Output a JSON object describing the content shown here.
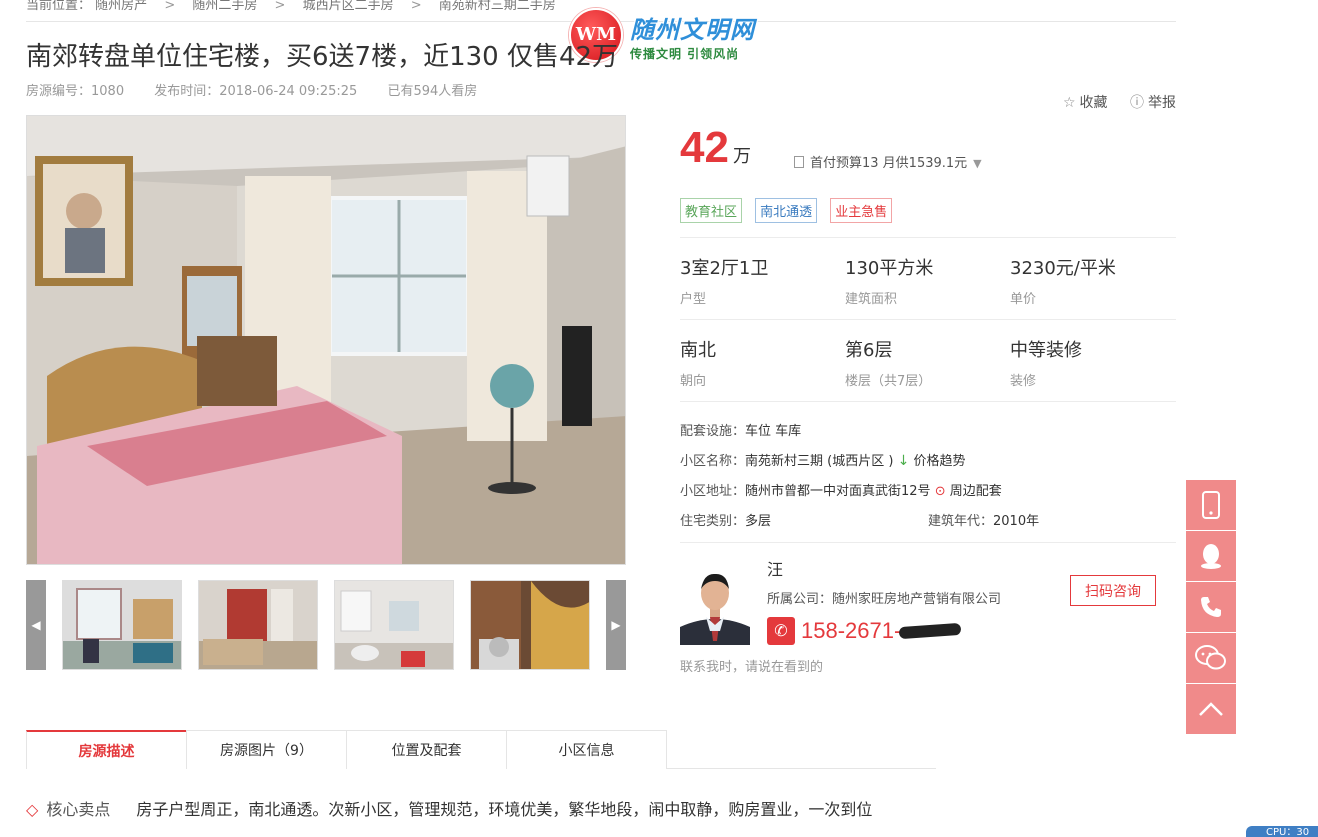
{
  "breadcrumb": {
    "prefix": "当前位置：",
    "items": [
      "随州房产",
      "随州二手房",
      "城西片区二手房",
      "南苑新村三期二手房"
    ],
    "sep": ">"
  },
  "logo": {
    "mark": "WM",
    "title": "随州文明网",
    "slogan": "传播文明  引领风尚"
  },
  "listing": {
    "title": "南郊转盘单位住宅楼，买6送7楼，近130 仅售42万",
    "code": "房源编号：1080",
    "published": "发布时间：2018-06-24 09:25:25",
    "views": "已有594人看房"
  },
  "actions": {
    "favorite": "收藏",
    "report": "举报"
  },
  "gallery": {
    "prev": "◀",
    "next": "▶"
  },
  "price": {
    "value": "42",
    "unit": "万",
    "budget": "首付预算13 月供1539.1元"
  },
  "tags": [
    "教育社区",
    "南北通透",
    "业主急售"
  ],
  "specs": [
    {
      "value": "3室2厅1卫",
      "label": "户型"
    },
    {
      "value": "130平方米",
      "label": "建筑面积"
    },
    {
      "value": "3230元/平米",
      "label": "单价"
    },
    {
      "value": "南北",
      "label": "朝向"
    },
    {
      "value": "第6层",
      "label": "楼层（共7层）"
    },
    {
      "value": "中等装修",
      "label": "装修"
    }
  ],
  "info": {
    "facilities_label": "配套设施：",
    "facilities_value": "车位 车库",
    "community_label": "小区名称：",
    "community_value": "南苑新村三期 (城西片区 )",
    "price_trend": "价格趋势",
    "address_label": "小区地址：",
    "address_value": "随州市曾都一中对面真武街12号",
    "nearby": "周边配套",
    "type_label": "住宅类别：",
    "type_value": "多层",
    "year_label": "建筑年代：",
    "year_value": "2010年"
  },
  "agent": {
    "name": "汪",
    "company": "所属公司：随州家旺房地产营销有限公司",
    "consult": "扫码咨询",
    "phone": "158-2671-",
    "note": "联系我时，请说在看到的"
  },
  "tabs": [
    "房源描述",
    "房源图片（9）",
    "位置及配套",
    "小区信息"
  ],
  "selling": {
    "label": "核心卖点",
    "text": "房子户型周正，南北通透。次新小区，管理规范，环境优美，繁华地段，闹中取静，购房置业，一次到位"
  },
  "system": {
    "cpu": "CPU：30"
  },
  "colors": {
    "accent": "#e4393c",
    "float": "#f08a8a"
  }
}
